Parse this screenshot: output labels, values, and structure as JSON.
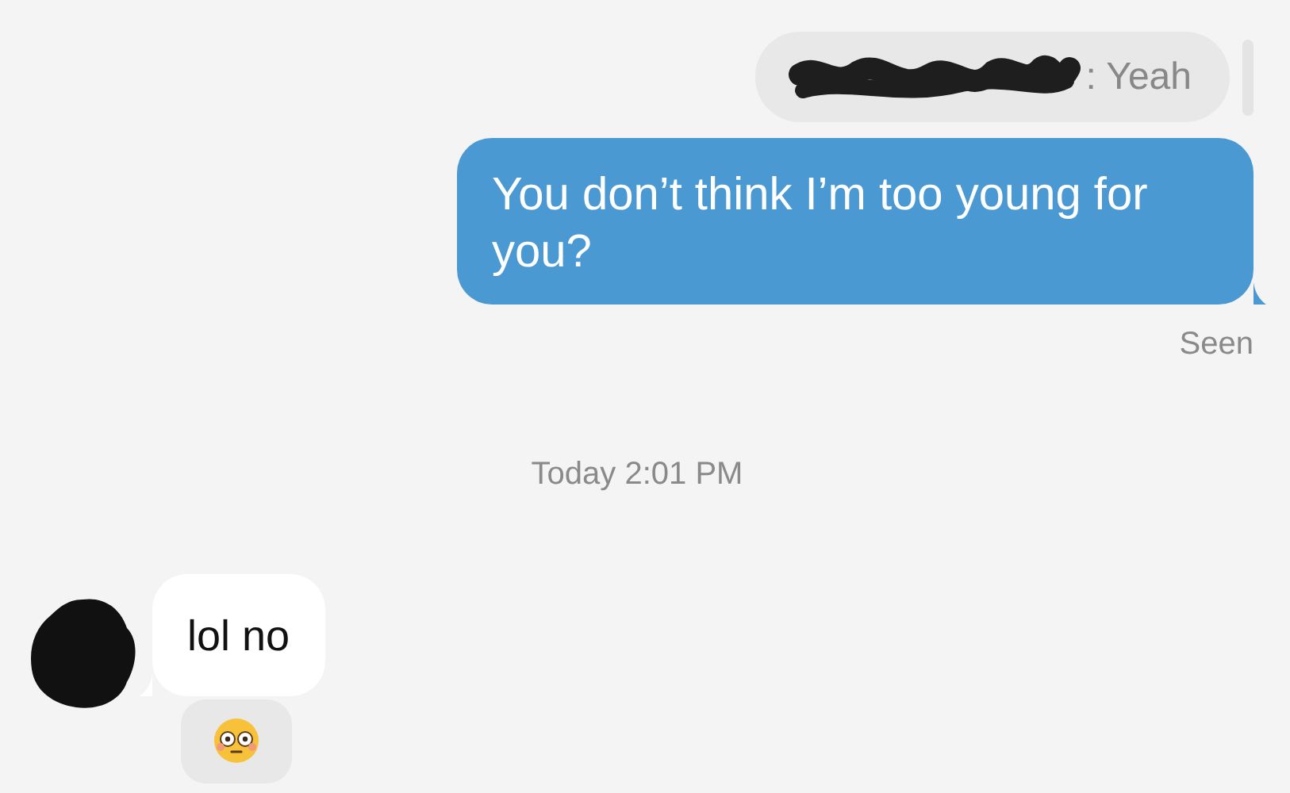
{
  "messages": [
    {
      "kind": "outgoing",
      "quote": ": Yeah",
      "text": "You don’t think I’m too young for you?",
      "receipt": "Seen"
    },
    {
      "kind": "timestamp",
      "text": "Today 2:01 PM"
    },
    {
      "kind": "incoming",
      "text": "lol no",
      "reaction": true
    }
  ]
}
